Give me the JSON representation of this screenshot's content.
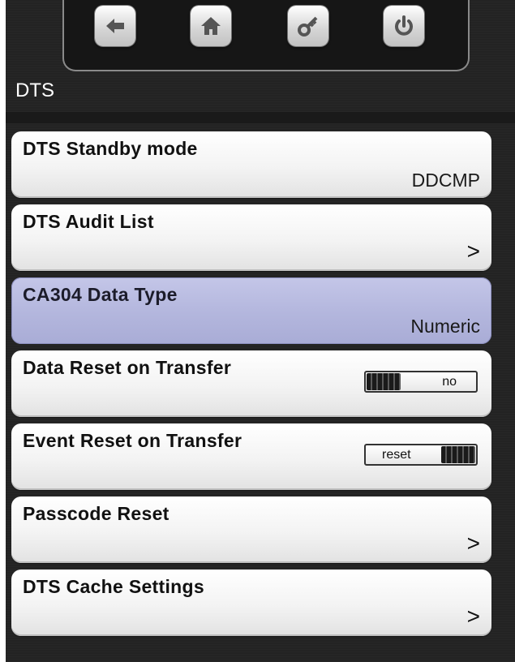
{
  "nav": {
    "back_icon": "back-arrow-icon",
    "home_icon": "home-icon",
    "key_icon": "key-icon",
    "power_icon": "power-icon"
  },
  "header": {
    "title": "DTS"
  },
  "colors": {
    "background": "#232323",
    "item_bg": "#f3f3f3",
    "selected_bg": "#b3b6dd"
  },
  "items": [
    {
      "label": "DTS Standby mode",
      "value": "DDCMP"
    },
    {
      "label": "DTS Audit List",
      "chevron": ">"
    },
    {
      "label": "CA304 Data Type",
      "value": "Numeric",
      "selected": true
    },
    {
      "label": "Data Reset on Transfer",
      "toggle": "no"
    },
    {
      "label": "Event Reset on Transfer",
      "toggle": "reset"
    },
    {
      "label": "Passcode Reset",
      "chevron": ">"
    },
    {
      "label": "DTS Cache Settings",
      "chevron": ">"
    }
  ]
}
